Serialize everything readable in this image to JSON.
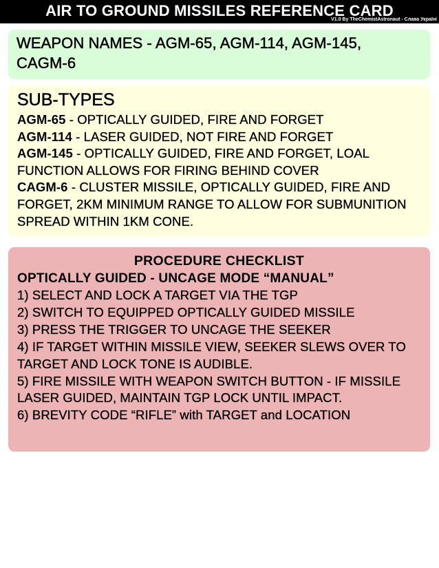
{
  "header": {
    "title": "AIR TO GROUND MISSILES REFERENCE CARD",
    "credit": "V1.0 By TheChemistAstronaut - Слава Україні"
  },
  "weapon_names": {
    "line1": "WEAPON NAMES - AGM-65, AGM-114, AGM-145,",
    "line2": "CAGM-6"
  },
  "subtypes": {
    "heading": "SUB-TYPES",
    "entries": [
      {
        "code": "AGM-65",
        "desc": " - OPTICALLY GUIDED, FIRE AND FORGET"
      },
      {
        "code": "AGM-114",
        "desc": " - LASER GUIDED, NOT FIRE AND FORGET"
      },
      {
        "code": "AGM-145",
        "desc": " - OPTICALLY GUIDED, FIRE AND FORGET, LOAL FUNCTION ALLOWS FOR FIRING BEHIND COVER"
      },
      {
        "code": "CAGM-6",
        "desc": " - CLUSTER MISSILE, OPTICALLY GUIDED, FIRE AND FORGET, 2KM MINIMUM RANGE TO ALLOW FOR SUBMUNITION SPREAD WITHIN 1KM CONE."
      }
    ]
  },
  "procedure": {
    "heading": "PROCEDURE CHECKLIST",
    "mode": "OPTICALLY GUIDED - UNCAGE MODE “MANUAL”",
    "steps": [
      "1) SELECT AND LOCK A TARGET VIA THE TGP",
      "2) SWITCH TO EQUIPPED OPTICALLY GUIDED MISSILE",
      "3) PRESS THE TRIGGER TO UNCAGE THE SEEKER",
      "4) IF TARGET WITHIN MISSILE VIEW, SEEKER SLEWS OVER TO TARGET AND LOCK TONE IS AUDIBLE.",
      "5) FIRE MISSILE WITH WEAPON SWITCH BUTTON - IF MISSILE LASER GUIDED, MAINTAIN TGP LOCK UNTIL IMPACT.",
      "6) BREVITY CODE “RIFLE” with TARGET and LOCATION"
    ]
  },
  "colors": {
    "header_bg": "#000000",
    "names_bg": "#d9fcd9",
    "subtypes_bg": "#ffffdf",
    "procedure_bg": "#ecb4b4"
  }
}
